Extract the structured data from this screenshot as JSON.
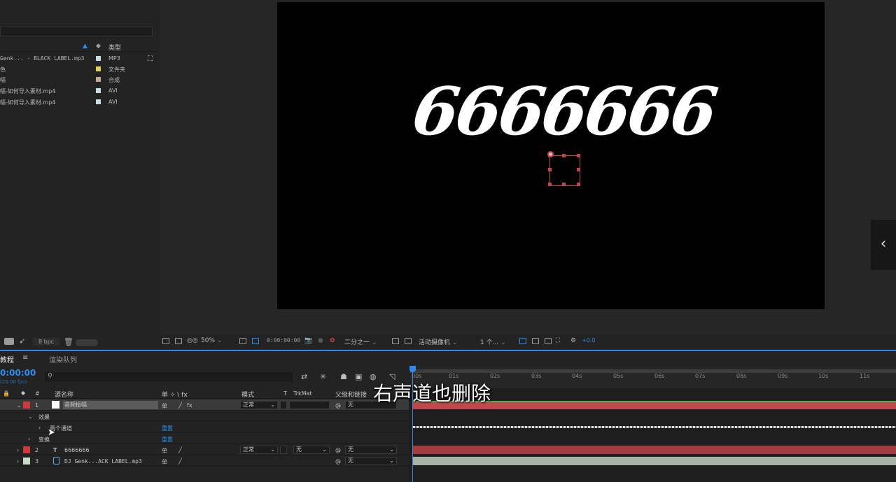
{
  "project": {
    "header_type": "类型",
    "items": [
      {
        "name": "Genk... - BLACK LABEL.mp3",
        "type": "MP3",
        "color": "#c4e0e4"
      },
      {
        "name": "色",
        "type": "文件夹",
        "color": "#e8d24a"
      },
      {
        "name": "幅",
        "type": "合成",
        "color": "#c9a98b"
      },
      {
        "name": "幅-如何导入素材.mp4",
        "type": "AVI",
        "color": "#c4e0e4"
      },
      {
        "name": "幅-如何导入素材.mp4",
        "type": "AVI",
        "color": "#c4e0e4"
      }
    ],
    "bpc": "8 bpc"
  },
  "viewer": {
    "comp_text": "6666666",
    "zoom": "50%",
    "timecode": "0:00:00:00",
    "resolution": "二分之一",
    "camera": "活动摄像机",
    "views": "1 个...",
    "exposure": "+0.0",
    "side_tab_icon": "chevron-left-icon"
  },
  "timeline": {
    "tab_active": "教程",
    "tab_other": "渲染队列",
    "current_time": "0:00:00",
    "fps": "(25.00 fps)",
    "search_placeholder": "",
    "columns": {
      "num": "#",
      "source_name": "源名称",
      "switches": "单 ✧ \\ fx",
      "mode": "模式",
      "t": "T",
      "trkmat": "TrkMat",
      "parent": "父级和链接"
    },
    "layers": [
      {
        "num": "1",
        "name": "音频振幅",
        "mode": "正常",
        "trkmat": "",
        "parent": "无",
        "color": "#d0383e",
        "kind": "solid"
      },
      {
        "num": "2",
        "name": "6666666",
        "mode": "正常",
        "trkmat": "无",
        "parent": "无",
        "color": "#d0383e",
        "kind": "text",
        "kind_glyph": "T"
      },
      {
        "num": "3",
        "name": "DJ Genk...ACK LABEL.mp3",
        "mode": "",
        "trkmat": "",
        "parent": "无",
        "color": "#c9dcc8",
        "kind": "audio"
      }
    ],
    "sub_rows": {
      "effects": "效果",
      "two_channel": "两个通道",
      "transform": "变换",
      "reset": "重置"
    },
    "ruler": [
      "00s",
      "01s",
      "02s",
      "03s",
      "04s",
      "05s",
      "06s",
      "07s",
      "08s",
      "09s",
      "10s",
      "11s"
    ]
  },
  "subtitle": "右声道也删除",
  "colors": {
    "accent": "#2d8ceb",
    "layer_red": "#c0484c",
    "audio_bar": "#a7b3a4"
  }
}
